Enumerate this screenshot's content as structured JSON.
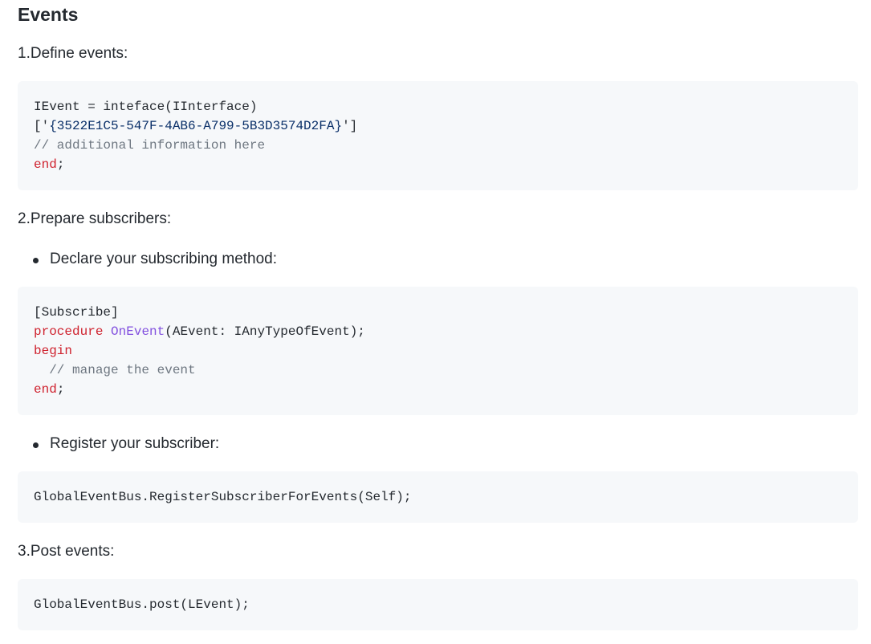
{
  "title": "Events",
  "steps": {
    "define_label": "1.Define events:",
    "prepare_label": "2.Prepare subscribers:",
    "post_label": "3.Post events:"
  },
  "bullets": {
    "declare": "Declare your subscribing method:",
    "register": "Register your subscriber:"
  },
  "code1": {
    "line1": "IEvent = inteface(IInterface)",
    "line2_open": "['",
    "line2_guid": "{3522E1C5-547F-4AB6-A799-5B3D3574D2FA}",
    "line2_close": "']",
    "line3": "// additional information here",
    "line4_kw": "end",
    "line4_rest": ";"
  },
  "code2": {
    "line1": "[Subscribe]",
    "line2_kw": "procedure",
    "line2_fn": "OnEvent",
    "line2_rest": "(AEvent: IAnyTypeOfEvent);",
    "line3_kw": "begin",
    "line4": "  // manage the event",
    "line5_kw": "end",
    "line5_rest": ";"
  },
  "code3": {
    "line1": "GlobalEventBus.RegisterSubscriberForEvents(Self);"
  },
  "code4": {
    "line1": "GlobalEventBus.post(LEvent);"
  },
  "colors": {
    "keyword": "#cf222e",
    "function": "#8250df",
    "comment": "#6e7781",
    "string": "#0a3069",
    "code_background": "#f6f8fa"
  }
}
